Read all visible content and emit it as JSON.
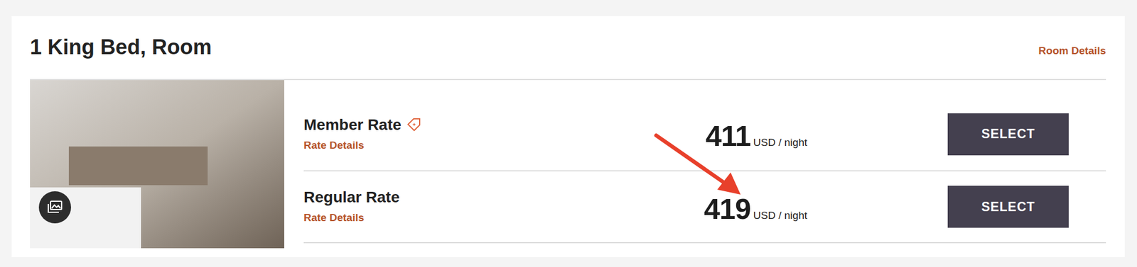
{
  "card": {
    "title": "1 King Bed, Room",
    "link": "Room Details"
  },
  "rates": [
    {
      "name": "Member Rate",
      "tagged": true,
      "details": "Rate Details",
      "price": "411",
      "unit": "USD / night",
      "button": "SELECT"
    },
    {
      "name": "Regular Rate",
      "tagged": false,
      "details": "Rate Details",
      "price": "419",
      "unit": "USD / night",
      "button": "SELECT"
    }
  ]
}
